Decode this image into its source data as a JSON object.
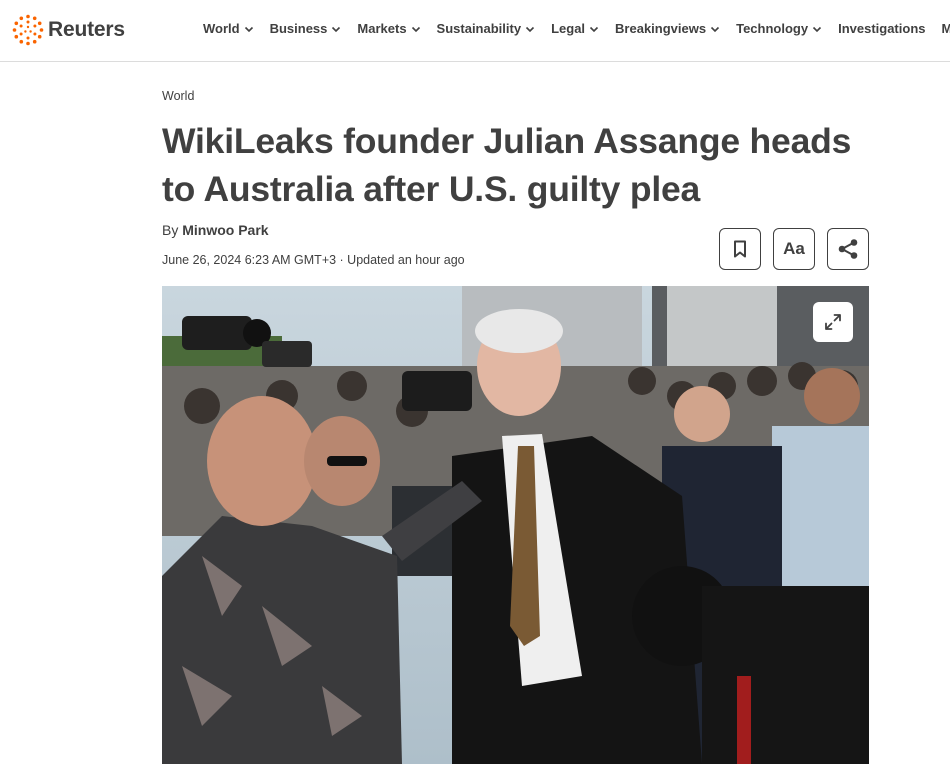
{
  "header": {
    "logo_text": "Reuters",
    "brand_color": "#fa6400",
    "nav": [
      {
        "label": "World",
        "has_dropdown": true
      },
      {
        "label": "Business",
        "has_dropdown": true
      },
      {
        "label": "Markets",
        "has_dropdown": true
      },
      {
        "label": "Sustainability",
        "has_dropdown": true
      },
      {
        "label": "Legal",
        "has_dropdown": true
      },
      {
        "label": "Breakingviews",
        "has_dropdown": true
      },
      {
        "label": "Technology",
        "has_dropdown": true
      },
      {
        "label": "Investigations",
        "has_dropdown": false
      },
      {
        "label": "More",
        "has_dropdown": false
      }
    ]
  },
  "article": {
    "kicker": "World",
    "headline": "WikiLeaks founder Julian Assange heads to Australia after U.S. guilty plea",
    "byline_prefix": "By",
    "author": "Minwoo Park",
    "dateline": "June 26, 2024 6:23 AM GMT+3 · Updated an hour ago",
    "actions": {
      "bookmark_icon": "bookmark-icon",
      "font_size_label": "Aa",
      "share_icon": "share-icon"
    },
    "photo": {
      "expand_icon": "expand-icon"
    }
  }
}
